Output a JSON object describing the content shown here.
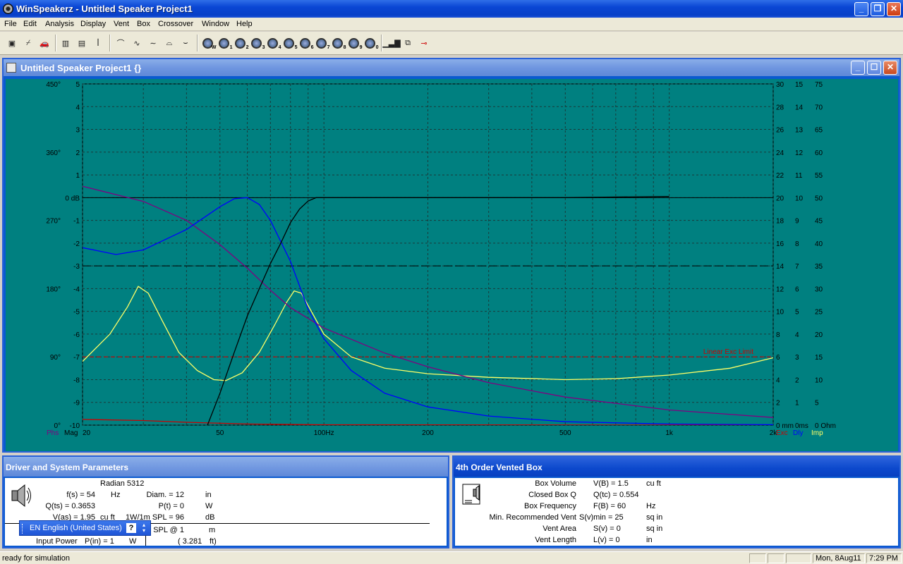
{
  "window": {
    "title": "WinSpeakerz - Untitled Speaker Project1"
  },
  "menu": [
    "File",
    "Edit",
    "Analysis",
    "Display",
    "Vent",
    "Box",
    "Crossover",
    "Window",
    "Help"
  ],
  "child_window": {
    "title": "Untitled Speaker Project1 {}"
  },
  "graph": {
    "linear_exc_limit_label": "Linear Exc Limit",
    "bottom_left_labels": [
      "Phs",
      "Mag"
    ],
    "bottom_right_labels": [
      "Exc",
      "Dly",
      "Imp"
    ],
    "colors": {
      "bg": "#008080",
      "grid": "#1a1a1a",
      "mag": "#000000",
      "phase": "#800080",
      "delay": "#0000ff",
      "excursion": "#cc0000",
      "impedance": "#ffff66",
      "limit": "#cc0000"
    },
    "x_ticks": [
      {
        "value": 20,
        "label": "20"
      },
      {
        "value": 50,
        "label": "50"
      },
      {
        "value": 100,
        "label": "100Hz"
      },
      {
        "value": 200,
        "label": "200"
      },
      {
        "value": 500,
        "label": "500"
      },
      {
        "value": 1000,
        "label": "1k"
      },
      {
        "value": 2000,
        "label": "2k"
      }
    ],
    "x_minor": [
      30,
      40,
      60,
      70,
      80,
      90,
      300,
      400,
      600,
      700,
      800,
      900
    ],
    "y_ticks": [
      {
        "value": 5,
        "mag": "5",
        "phase": "450°",
        "exc": "30",
        "dly": "15",
        "imp": "75"
      },
      {
        "value": 4,
        "mag": "4",
        "phase": "",
        "exc": "28",
        "dly": "14",
        "imp": "70"
      },
      {
        "value": 3,
        "mag": "3",
        "phase": "",
        "exc": "26",
        "dly": "13",
        "imp": "65"
      },
      {
        "value": 2,
        "mag": "2",
        "phase": "360°",
        "exc": "24",
        "dly": "12",
        "imp": "60"
      },
      {
        "value": 1,
        "mag": "1",
        "phase": "",
        "exc": "22",
        "dly": "11",
        "imp": "55"
      },
      {
        "value": 0,
        "mag": "0 dB",
        "phase": "",
        "exc": "20",
        "dly": "10",
        "imp": "50"
      },
      {
        "value": -1,
        "mag": "-1",
        "phase": "270°",
        "exc": "18",
        "dly": "9",
        "imp": "45"
      },
      {
        "value": -2,
        "mag": "-2",
        "phase": "",
        "exc": "16",
        "dly": "8",
        "imp": "40"
      },
      {
        "value": -3,
        "mag": "-3",
        "phase": "",
        "exc": "14",
        "dly": "7",
        "imp": "35"
      },
      {
        "value": -4,
        "mag": "-4",
        "phase": "180°",
        "exc": "12",
        "dly": "6",
        "imp": "30"
      },
      {
        "value": -5,
        "mag": "-5",
        "phase": "",
        "exc": "10",
        "dly": "5",
        "imp": "25"
      },
      {
        "value": -6,
        "mag": "-6",
        "phase": "",
        "exc": "8",
        "dly": "4",
        "imp": "20"
      },
      {
        "value": -7,
        "mag": "-7",
        "phase": "90°",
        "exc": "6",
        "dly": "3",
        "imp": "15"
      },
      {
        "value": -8,
        "mag": "-8",
        "phase": "",
        "exc": "4",
        "dly": "2",
        "imp": "10"
      },
      {
        "value": -9,
        "mag": "-9",
        "phase": "",
        "exc": "2",
        "dly": "1",
        "imp": "5"
      },
      {
        "value": -10,
        "mag": "-10",
        "phase": "0°",
        "exc": "0 mm",
        "dly": "0ms",
        "imp": "0 Ohm"
      }
    ],
    "curves": {
      "magnitude": [
        [
          40,
          -12
        ],
        [
          43,
          -11
        ],
        [
          46,
          -10
        ],
        [
          50,
          -8.6
        ],
        [
          55,
          -6.8
        ],
        [
          60,
          -5.2
        ],
        [
          65,
          -4
        ],
        [
          70,
          -2.9
        ],
        [
          75,
          -2
        ],
        [
          80,
          -1.1
        ],
        [
          85,
          -0.5
        ],
        [
          90,
          -0.15
        ],
        [
          95,
          0
        ],
        [
          100,
          0
        ],
        [
          200,
          0
        ],
        [
          500,
          0
        ],
        [
          1000,
          0.05
        ]
      ],
      "phase_deg": [
        [
          20,
          315
        ],
        [
          30,
          295
        ],
        [
          40,
          270
        ],
        [
          50,
          238
        ],
        [
          60,
          207
        ],
        [
          70,
          178
        ],
        [
          80,
          155
        ],
        [
          100,
          128
        ],
        [
          150,
          95
        ],
        [
          200,
          77
        ],
        [
          300,
          56
        ],
        [
          500,
          37
        ],
        [
          1000,
          20
        ],
        [
          2000,
          10
        ]
      ],
      "delay_ms": [
        [
          20,
          7.8
        ],
        [
          25,
          7.5
        ],
        [
          30,
          7.7
        ],
        [
          40,
          8.6
        ],
        [
          50,
          9.6
        ],
        [
          55,
          9.95
        ],
        [
          60,
          10
        ],
        [
          65,
          9.7
        ],
        [
          70,
          9
        ],
        [
          80,
          7.2
        ],
        [
          90,
          5.1
        ],
        [
          100,
          3.8
        ],
        [
          120,
          2.4
        ],
        [
          150,
          1.4
        ],
        [
          200,
          0.8
        ],
        [
          300,
          0.4
        ],
        [
          500,
          0.15
        ],
        [
          1000,
          0.05
        ],
        [
          2000,
          0.02
        ]
      ],
      "excursion_mm": [
        [
          20,
          0.5
        ],
        [
          30,
          0.4
        ],
        [
          40,
          0.25
        ],
        [
          60,
          0.1
        ],
        [
          100,
          0.03
        ],
        [
          2000,
          0
        ]
      ],
      "impedance_ohm": [
        [
          20,
          14
        ],
        [
          24,
          20
        ],
        [
          27,
          26
        ],
        [
          29,
          30.5
        ],
        [
          31,
          29
        ],
        [
          34,
          23
        ],
        [
          38,
          16
        ],
        [
          43,
          12
        ],
        [
          48,
          10
        ],
        [
          52,
          9.8
        ],
        [
          58,
          11.5
        ],
        [
          65,
          16
        ],
        [
          72,
          22
        ],
        [
          78,
          27
        ],
        [
          82,
          29.5
        ],
        [
          86,
          29
        ],
        [
          92,
          25
        ],
        [
          100,
          20
        ],
        [
          120,
          15
        ],
        [
          150,
          12.5
        ],
        [
          200,
          11.3
        ],
        [
          300,
          10.5
        ],
        [
          500,
          10
        ],
        [
          700,
          10.2
        ],
        [
          1000,
          11
        ],
        [
          1500,
          12.5
        ],
        [
          2000,
          14.8
        ]
      ]
    },
    "limit_value": -7,
    "dash_reference_value": -3
  },
  "driver_panel": {
    "header": "Driver and System Parameters",
    "driver_name": "Radian 5312",
    "rows": [
      {
        "l": "f(s) = 54",
        "lu": "Hz",
        "r": "Diam. = 12",
        "ru": "in"
      },
      {
        "l": "Q(ts) = 0.3653",
        "lu": "",
        "r": "P(t) = 0",
        "ru": "W"
      },
      {
        "l": "V(as) = 1.95",
        "lu": "cu ft",
        "r": "1W/1m SPL = 96",
        "ru": "dB"
      },
      {
        "l": "",
        "lu": "",
        "r": "SPL @ 1",
        "ru": "m"
      }
    ],
    "input_power_label": "Input Power",
    "input_power": "P(in) = 1",
    "input_power_unit": "W",
    "distance_ft": "( 3.281",
    "distance_ft_unit": "ft)"
  },
  "box_panel": {
    "header": "4th Order Vented Box",
    "rows": [
      {
        "label": "Box Volume",
        "value": "V(B) = 1.5",
        "unit": "cu ft"
      },
      {
        "label": "Closed Box Q",
        "value": "Q(tc) = 0.554",
        "unit": ""
      },
      {
        "label": "Box Frequency",
        "value": "F(B) = 60",
        "unit": "Hz"
      },
      {
        "label": "Min. Recommended Vent",
        "value": "S(v)min = 25",
        "unit": "sq in"
      },
      {
        "label": "Vent Area",
        "value": "S(v) = 0",
        "unit": "sq in"
      },
      {
        "label": "Vent Length",
        "value": "L(v) = 0",
        "unit": "in"
      }
    ]
  },
  "langbar": {
    "label": "EN English (United States)"
  },
  "statusbar": {
    "message": "ready for simulation",
    "date": "Mon, 8Aug11",
    "time": "7:29  PM"
  }
}
